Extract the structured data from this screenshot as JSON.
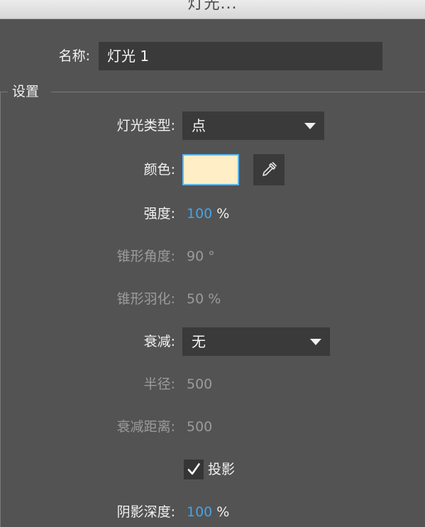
{
  "window": {
    "title": "灯光..."
  },
  "name": {
    "label": "名称:",
    "value": "灯光 1"
  },
  "settings": {
    "group_title": "设置",
    "light_type": {
      "label": "灯光类型:",
      "selected": "点"
    },
    "color": {
      "label": "颜色:",
      "swatch_color": "#FFEEC6",
      "eyedropper_icon": "eyedropper-icon"
    },
    "intensity": {
      "label": "强度:",
      "value": "100",
      "unit": "%"
    },
    "cone_angle": {
      "label": "锥形角度:",
      "value": "90",
      "unit": "°"
    },
    "cone_feather": {
      "label": "锥形羽化:",
      "value": "50",
      "unit": "%"
    },
    "falloff": {
      "label": "衰减:",
      "selected": "无"
    },
    "radius": {
      "label": "半径:",
      "value": "500"
    },
    "falloff_distance": {
      "label": "衰减距离:",
      "value": "500"
    },
    "cast_shadow": {
      "label": "投影",
      "checked": true
    },
    "shadow_depth": {
      "label": "阴影深度:",
      "value": "100",
      "unit": "%"
    }
  },
  "colors": {
    "accent_value": "#47A4E6",
    "panel_bg": "#535353",
    "field_bg": "#3A3A3A",
    "disabled_text": "#9B9B9B"
  }
}
